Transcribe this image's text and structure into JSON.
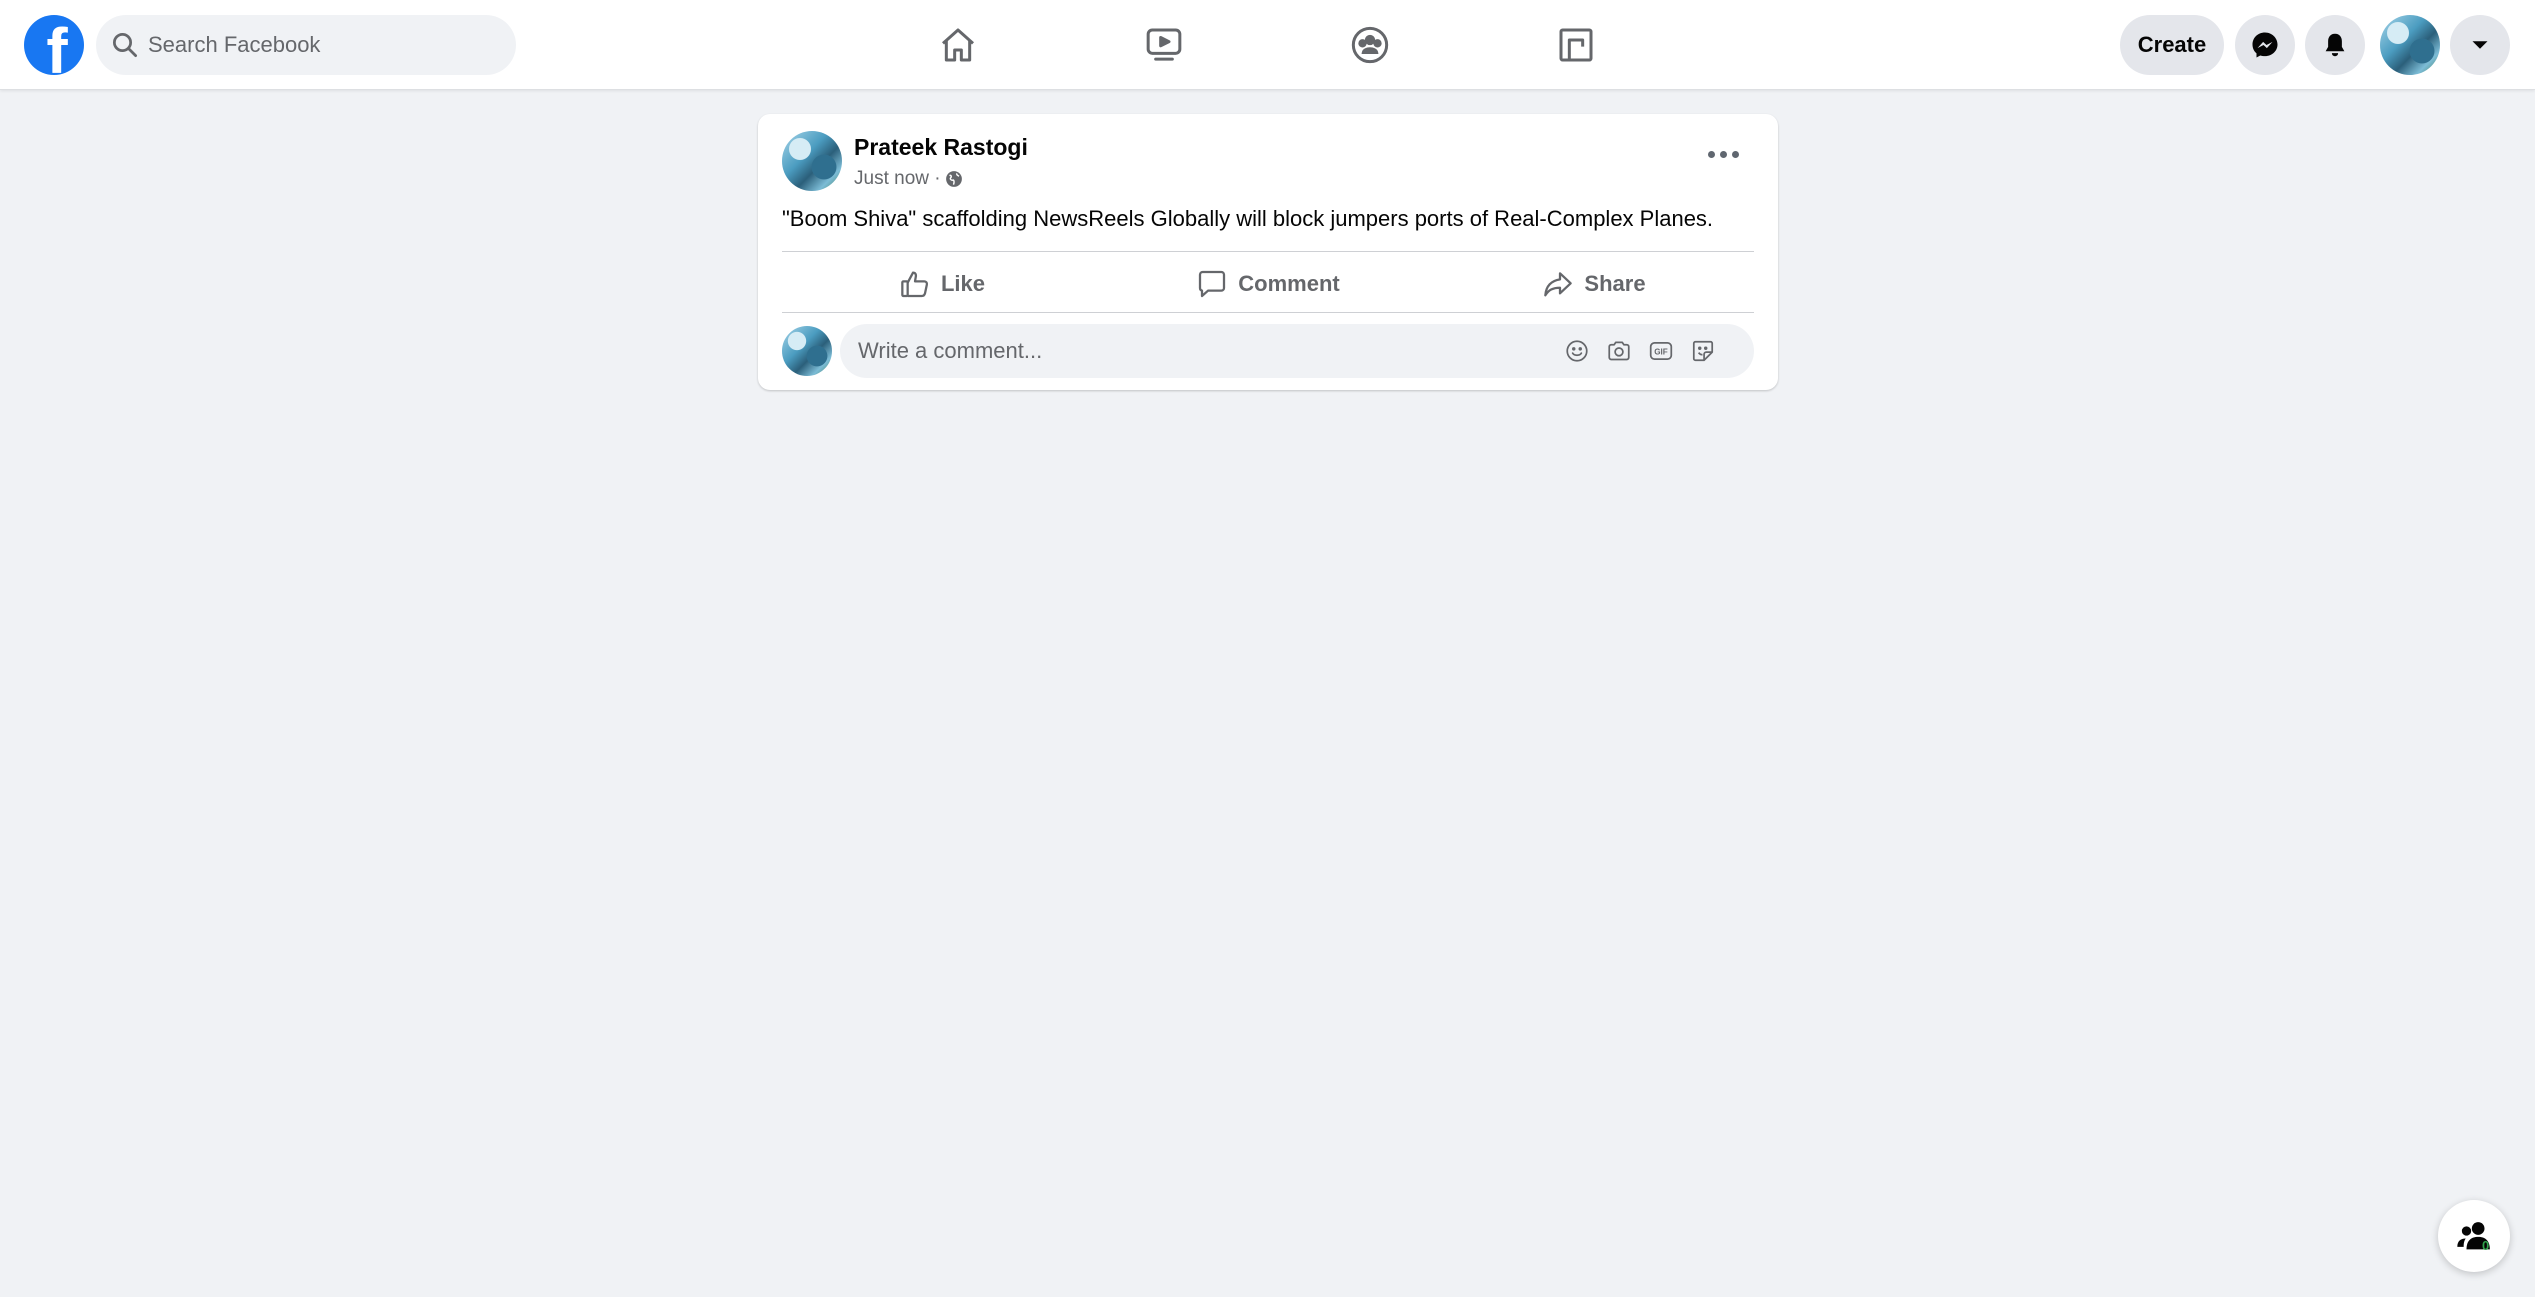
{
  "app": "Facebook",
  "colors": {
    "brand": "#1877f2",
    "background": "#f0f2f5",
    "secondary_text": "#65676b",
    "online_green": "#31a24c"
  },
  "header": {
    "logo_letter": "f",
    "search_placeholder": "Search Facebook",
    "nav_tabs": [
      {
        "icon": "home-icon"
      },
      {
        "icon": "watch-icon"
      },
      {
        "icon": "groups-icon"
      },
      {
        "icon": "gaming-icon"
      }
    ],
    "create_label": "Create",
    "messenger_icon": "messenger-icon",
    "notifications_icon": "bell-icon",
    "account_menu_icon": "caret-down-icon"
  },
  "post": {
    "author": "Prateek Rastogi",
    "timestamp": "Just now ·",
    "audience_icon": "globe-icon",
    "text": "\"Boom Shiva\" scaffolding NewsReels Globally will block jumpers ports of Real-Complex Planes.",
    "actions": {
      "like": "Like",
      "comment": "Comment",
      "share": "Share"
    },
    "comment_placeholder": "Write a comment...",
    "comment_tools": [
      "emoji-icon",
      "camera-icon",
      "gif-icon",
      "sticker-icon"
    ]
  },
  "contacts": {
    "count": "0"
  }
}
